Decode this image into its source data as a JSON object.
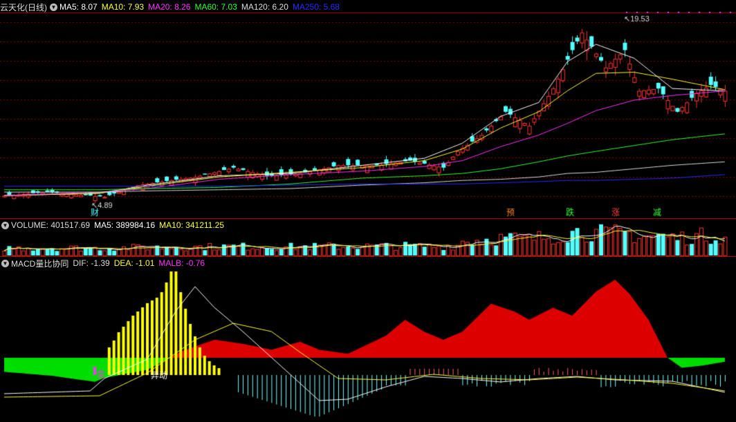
{
  "colors": {
    "ma5": "#ffffff",
    "ma10": "#ffff33",
    "ma20": "#ff33ff",
    "ma60": "#33ff33",
    "ma120": "#dddddd",
    "ma250": "#2a2aff",
    "up": "#ff3333",
    "down": "#54ffff",
    "yellow_bar": "#ffff00",
    "red_area": "#dd0000",
    "green_area": "#00dd00",
    "grid": "#8a0000"
  },
  "price_panel": {
    "title": "云天化(日线)",
    "ma_items": [
      {
        "key": "ma5",
        "text": "MA5: 8.07"
      },
      {
        "key": "ma10",
        "text": "MA10: 7.93"
      },
      {
        "key": "ma20",
        "text": "MA20: 8.26"
      },
      {
        "key": "ma60",
        "text": "MA60: 7.03"
      },
      {
        "key": "ma120",
        "text": "MA120: 6.20"
      },
      {
        "key": "ma250",
        "text": "MA250: 5.68"
      }
    ],
    "high_label": "19.53",
    "low_label": "4.89",
    "markers": [
      {
        "text": "财",
        "color": "#54ffff"
      },
      {
        "text": "预",
        "color": "#ff8800"
      },
      {
        "text": "跌",
        "color": "#33ff33"
      },
      {
        "text": "涨",
        "color": "#ff4444"
      },
      {
        "text": "减",
        "color": "#33ff33"
      }
    ]
  },
  "volume_panel": {
    "items": [
      {
        "key": "vol",
        "text": "VOLUME: 401517.69"
      },
      {
        "key": "ma5",
        "text": "MA5: 389984.16"
      },
      {
        "key": "ma10",
        "text": "MA10: 341211.25"
      }
    ]
  },
  "macd_panel": {
    "items": [
      {
        "key": "title",
        "text": "MACD量比协同"
      },
      {
        "key": "dif",
        "text": "DIF: -1.39"
      },
      {
        "key": "dea",
        "text": "DEA: -1.01"
      },
      {
        "key": "malb",
        "text": "MALB: -0.76"
      }
    ],
    "annotation": "异动"
  },
  "chart_data": {
    "type": "candlestick",
    "panels": [
      "price",
      "volume",
      "macd"
    ],
    "y_range": [
      4.0,
      20.5
    ],
    "high": 19.53,
    "low": 4.89,
    "ma_anchor": [
      [
        0,
        5.0,
        5.0,
        5.0,
        5.5,
        5.3,
        5.8
      ],
      [
        20,
        5.2,
        5.2,
        5.3,
        5.5,
        5.3,
        5.8
      ],
      [
        30,
        5.9,
        5.8,
        5.6,
        5.6,
        5.4,
        5.8
      ],
      [
        45,
        6.7,
        6.6,
        6.4,
        5.7,
        5.5,
        5.8
      ],
      [
        60,
        6.9,
        7.0,
        6.8,
        6.0,
        5.6,
        5.9
      ],
      [
        75,
        7.6,
        7.4,
        7.1,
        6.5,
        5.9,
        6.0
      ],
      [
        88,
        8.2,
        8.0,
        7.5,
        6.7,
        6.1,
        6.0
      ],
      [
        96,
        9.5,
        9.0,
        8.0,
        6.9,
        6.3,
        6.0
      ],
      [
        104,
        11.8,
        10.8,
        9.2,
        7.3,
        6.4,
        6.1
      ],
      [
        112,
        13.0,
        12.2,
        10.2,
        7.9,
        6.6,
        6.2
      ],
      [
        118,
        16.5,
        14.0,
        11.2,
        8.4,
        6.9,
        6.3
      ],
      [
        124,
        18.0,
        15.5,
        12.3,
        8.8,
        7.0,
        6.3
      ],
      [
        132,
        16.8,
        15.6,
        13.2,
        9.3,
        7.3,
        6.4
      ],
      [
        140,
        14.2,
        15.0,
        13.6,
        9.8,
        7.6,
        6.5
      ],
      [
        151,
        14.0,
        14.1,
        14.0,
        10.3,
        7.9,
        6.8
      ]
    ],
    "close_anchor": [
      [
        0,
        5.0
      ],
      [
        9,
        5.3
      ],
      [
        18,
        5.0
      ],
      [
        21,
        4.89
      ],
      [
        28,
        5.9
      ],
      [
        40,
        6.6
      ],
      [
        48,
        7.4
      ],
      [
        55,
        6.7
      ],
      [
        62,
        6.9
      ],
      [
        70,
        7.6
      ],
      [
        78,
        7.6
      ],
      [
        85,
        8.0
      ],
      [
        92,
        7.4
      ],
      [
        95,
        8.8
      ],
      [
        100,
        10.2
      ],
      [
        105,
        12.2
      ],
      [
        110,
        11.0
      ],
      [
        115,
        14.2
      ],
      [
        119,
        17.5
      ],
      [
        121,
        19.0
      ],
      [
        126,
        16.0
      ],
      [
        130,
        17.5
      ],
      [
        133,
        14.0
      ],
      [
        137,
        14.2
      ],
      [
        141,
        12.2
      ],
      [
        145,
        13.8
      ],
      [
        148,
        14.5
      ],
      [
        151,
        14.0
      ]
    ],
    "macd_anchor": [
      [
        0,
        -0.35
      ],
      [
        10,
        -0.45
      ],
      [
        19,
        -0.6
      ],
      [
        21,
        -0.5
      ],
      [
        30,
        -0.3
      ],
      [
        37,
        0.15
      ],
      [
        44,
        0.45
      ],
      [
        50,
        0.35
      ],
      [
        56,
        0.2
      ],
      [
        62,
        0.4
      ],
      [
        66,
        0.2
      ],
      [
        72,
        0.1
      ],
      [
        80,
        0.55
      ],
      [
        84,
        0.95
      ],
      [
        88,
        0.65
      ],
      [
        92,
        0.45
      ],
      [
        96,
        0.65
      ],
      [
        102,
        1.35
      ],
      [
        107,
        1.15
      ],
      [
        110,
        0.95
      ],
      [
        115,
        1.25
      ],
      [
        119,
        1.05
      ],
      [
        124,
        1.65
      ],
      [
        128,
        1.95
      ],
      [
        131,
        1.6
      ],
      [
        135,
        0.95
      ],
      [
        139,
        0.0
      ],
      [
        142,
        -0.25
      ],
      [
        146,
        -0.2
      ],
      [
        151,
        -0.1
      ]
    ]
  }
}
